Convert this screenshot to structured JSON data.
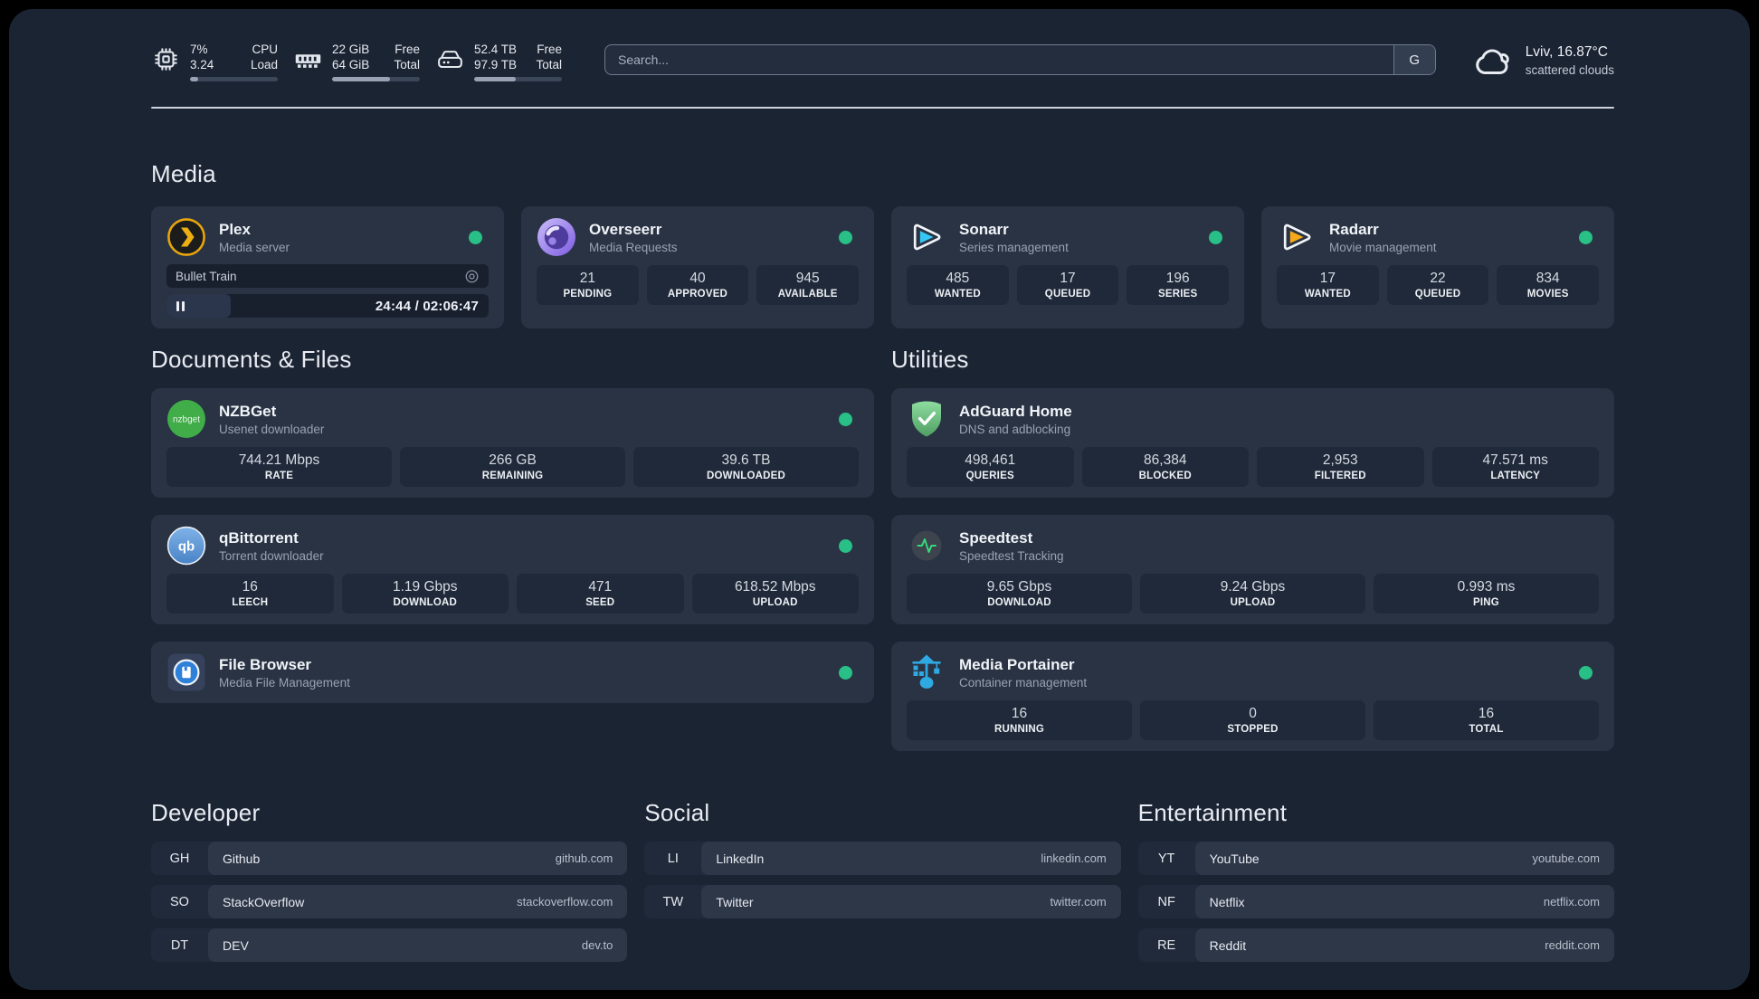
{
  "topbar": {
    "cpu": {
      "value1": "7%",
      "value2": "3.24",
      "label1": "CPU",
      "label2": "Load",
      "progress_pct": 9
    },
    "memory": {
      "value1": "22 GiB",
      "value2": "64 GiB",
      "label1": "Free",
      "label2": "Total",
      "progress_pct": 66
    },
    "disk": {
      "value1": "52.4 TB",
      "value2": "97.9 TB",
      "label1": "Free",
      "label2": "Total",
      "progress_pct": 47
    },
    "search": {
      "placeholder": "Search...",
      "value": "",
      "provider_label": "G"
    },
    "weather": {
      "location": "Lviv, 16.87°C",
      "condition": "scattered clouds"
    }
  },
  "colors": {
    "status_online": "#29c087",
    "plex_accent": "#e8a50d",
    "panel_bg": "#1b2433",
    "card_bg": "#293343"
  },
  "icons": {
    "topbar": [
      "cpu-chip-icon",
      "ram-icon",
      "disk-drive-icon",
      "cloud-icon"
    ],
    "plex_media_row": "target-icon",
    "plex_state": "pause-icon"
  },
  "media": {
    "title": "Media",
    "plex": {
      "title": "Plex",
      "subtitle": "Media server",
      "online": true,
      "now_playing": {
        "title": "Bullet Train",
        "state": "paused",
        "time": "24:44 / 02:06:47",
        "progress_pct": 20
      }
    },
    "overseerr": {
      "title": "Overseerr",
      "subtitle": "Media Requests",
      "online": true,
      "stats": [
        {
          "value": "21",
          "label": "PENDING"
        },
        {
          "value": "40",
          "label": "APPROVED"
        },
        {
          "value": "945",
          "label": "AVAILABLE"
        }
      ]
    },
    "sonarr": {
      "title": "Sonarr",
      "subtitle": "Series management",
      "online": true,
      "stats": [
        {
          "value": "485",
          "label": "WANTED"
        },
        {
          "value": "17",
          "label": "QUEUED"
        },
        {
          "value": "196",
          "label": "SERIES"
        }
      ]
    },
    "radarr": {
      "title": "Radarr",
      "subtitle": "Movie management",
      "online": true,
      "stats": [
        {
          "value": "17",
          "label": "WANTED"
        },
        {
          "value": "22",
          "label": "QUEUED"
        },
        {
          "value": "834",
          "label": "MOVIES"
        }
      ]
    }
  },
  "documents": {
    "title": "Documents & Files",
    "nzbget": {
      "title": "NZBGet",
      "subtitle": "Usenet downloader",
      "online": true,
      "icon_text": "nzbget",
      "stats": [
        {
          "value": "744.21 Mbps",
          "label": "RATE"
        },
        {
          "value": "266 GB",
          "label": "REMAINING"
        },
        {
          "value": "39.6 TB",
          "label": "DOWNLOADED"
        }
      ]
    },
    "qbittorrent": {
      "title": "qBittorrent",
      "subtitle": "Torrent downloader",
      "online": true,
      "icon_text": "qb",
      "stats": [
        {
          "value": "16",
          "label": "LEECH"
        },
        {
          "value": "1.19 Gbps",
          "label": "DOWNLOAD"
        },
        {
          "value": "471",
          "label": "SEED"
        },
        {
          "value": "618.52 Mbps",
          "label": "UPLOAD"
        }
      ]
    },
    "filebrowser": {
      "title": "File Browser",
      "subtitle": "Media File Management",
      "online": true
    }
  },
  "utilities": {
    "title": "Utilities",
    "adguard": {
      "title": "AdGuard Home",
      "subtitle": "DNS and adblocking",
      "stats": [
        {
          "value": "498,461",
          "label": "QUERIES"
        },
        {
          "value": "86,384",
          "label": "BLOCKED"
        },
        {
          "value": "2,953",
          "label": "FILTERED"
        },
        {
          "value": "47.571 ms",
          "label": "LATENCY"
        }
      ]
    },
    "speedtest": {
      "title": "Speedtest",
      "subtitle": "Speedtest Tracking",
      "stats": [
        {
          "value": "9.65 Gbps",
          "label": "DOWNLOAD"
        },
        {
          "value": "9.24 Gbps",
          "label": "UPLOAD"
        },
        {
          "value": "0.993 ms",
          "label": "PING"
        }
      ]
    },
    "portainer": {
      "title": "Media Portainer",
      "subtitle": "Container management",
      "online": true,
      "stats": [
        {
          "value": "16",
          "label": "RUNNING"
        },
        {
          "value": "0",
          "label": "STOPPED"
        },
        {
          "value": "16",
          "label": "TOTAL"
        }
      ]
    }
  },
  "bookmarks": {
    "developer": {
      "title": "Developer",
      "items": [
        {
          "abbr": "GH",
          "name": "Github",
          "url": "github.com"
        },
        {
          "abbr": "SO",
          "name": "StackOverflow",
          "url": "stackoverflow.com"
        },
        {
          "abbr": "DT",
          "name": "DEV",
          "url": "dev.to"
        }
      ]
    },
    "social": {
      "title": "Social",
      "items": [
        {
          "abbr": "LI",
          "name": "LinkedIn",
          "url": "linkedin.com"
        },
        {
          "abbr": "TW",
          "name": "Twitter",
          "url": "twitter.com"
        }
      ]
    },
    "entertainment": {
      "title": "Entertainment",
      "items": [
        {
          "abbr": "YT",
          "name": "YouTube",
          "url": "youtube.com"
        },
        {
          "abbr": "NF",
          "name": "Netflix",
          "url": "netflix.com"
        },
        {
          "abbr": "RE",
          "name": "Reddit",
          "url": "reddit.com"
        }
      ]
    }
  }
}
